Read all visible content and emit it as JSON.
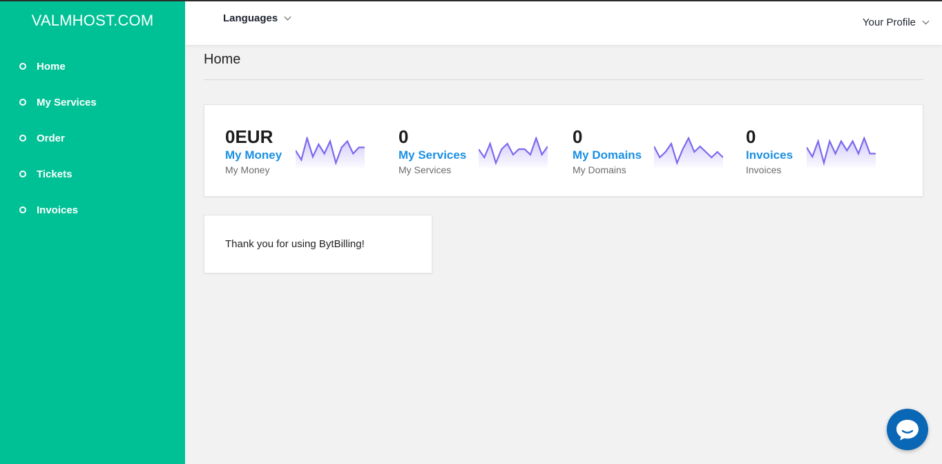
{
  "brand": "VALMHOST.COM",
  "sidebar": {
    "items": [
      {
        "label": "Home"
      },
      {
        "label": "My Services"
      },
      {
        "label": "Order"
      },
      {
        "label": "Tickets"
      },
      {
        "label": "Invoices"
      }
    ]
  },
  "header": {
    "languages_label": "Languages",
    "profile_label": "Your Profile"
  },
  "page": {
    "title": "Home"
  },
  "stats": [
    {
      "value": "0EUR",
      "link": "My Money",
      "sub": "My Money",
      "spark": [
        5,
        2,
        9,
        3,
        7,
        4,
        8,
        1,
        6,
        8,
        4,
        6,
        6
      ]
    },
    {
      "value": "0",
      "link": "My Services",
      "sub": "My Services",
      "spark": [
        6,
        3,
        8,
        1,
        6,
        8,
        4,
        6,
        6,
        4,
        10,
        4,
        7
      ]
    },
    {
      "value": "0",
      "link": "My Domains",
      "sub": "My Domains",
      "spark": [
        7,
        3,
        5,
        8,
        1,
        6,
        10,
        5,
        7,
        5,
        3,
        5,
        3
      ]
    },
    {
      "value": "0",
      "link": "Invoices",
      "sub": "Invoices",
      "spark": [
        6,
        3,
        8,
        1,
        8,
        4,
        8,
        5,
        8,
        4,
        9,
        4,
        4
      ]
    }
  ],
  "message": "Thank you for using BytBilling!",
  "colors": {
    "sidebar": "#00c195",
    "link": "#1a8fe3",
    "sparkline": "#7b68ee",
    "chat": "#0a67b5"
  },
  "icons": {
    "nav_bullet": "circle-outline-icon",
    "dropdown": "chevron-down-icon",
    "chat": "chat-bubble-icon"
  }
}
